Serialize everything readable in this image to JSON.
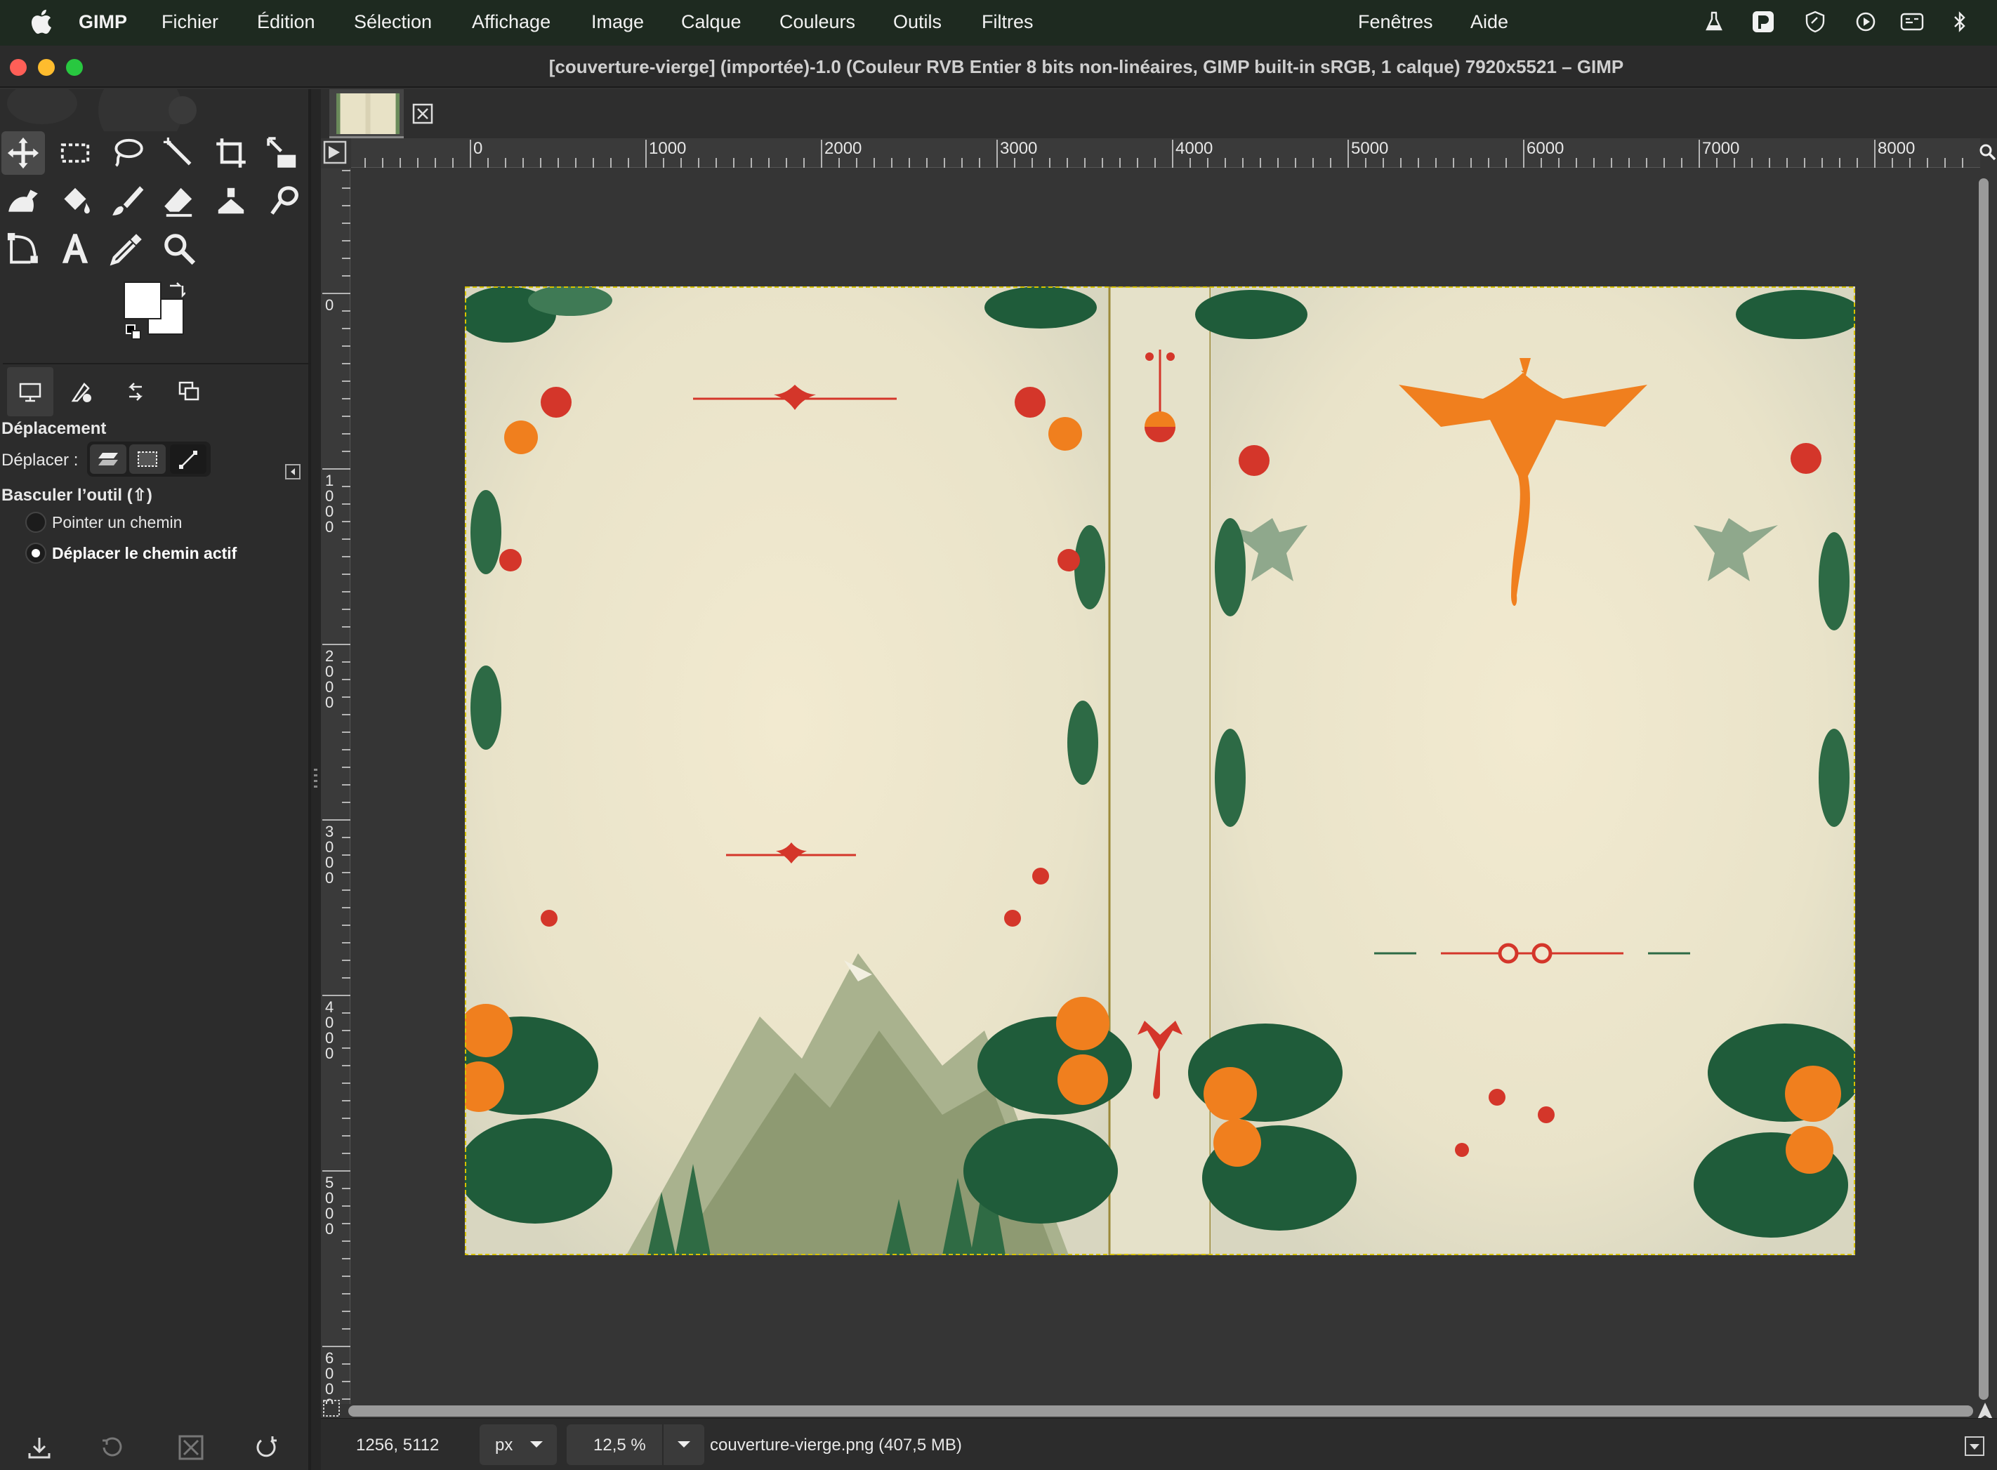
{
  "menubar": {
    "app": "GIMP",
    "items": [
      "Fichier",
      "Édition",
      "Sélection",
      "Affichage",
      "Image",
      "Calque",
      "Couleurs",
      "Outils",
      "Filtres"
    ],
    "right_items": [
      "Fenêtres",
      "Aide"
    ]
  },
  "window": {
    "title": "[couverture-vierge] (importée)-1.0 (Couleur RVB Entier 8 bits non-linéaires, GIMP built-in sRGB, 1 calque) 7920x5521 – GIMP"
  },
  "tool_options": {
    "heading": "Déplacement",
    "move_label": "Déplacer :",
    "toggle_label": "Basculer l’outil (⇧)",
    "radio_1": "Pointer un chemin",
    "radio_2": "Déplacer le chemin actif",
    "selected_radio": 2
  },
  "ruler": {
    "h_labels": [
      "0",
      "1000",
      "2000",
      "3000",
      "4000",
      "5000",
      "6000",
      "7000",
      "8000"
    ],
    "v_labels": [
      "0",
      "1000",
      "2000",
      "3000",
      "4000",
      "5000",
      "6000"
    ]
  },
  "status": {
    "coords": "1256, 5112",
    "unit": "px",
    "zoom": "12,5 %",
    "file": "couverture-vierge.png (407,5 MB)"
  },
  "colors": {
    "accent_orange": "#f07f1e",
    "red": "#d4362a",
    "green_dark": "#1f5c3a",
    "paper": "#efe8cf"
  }
}
